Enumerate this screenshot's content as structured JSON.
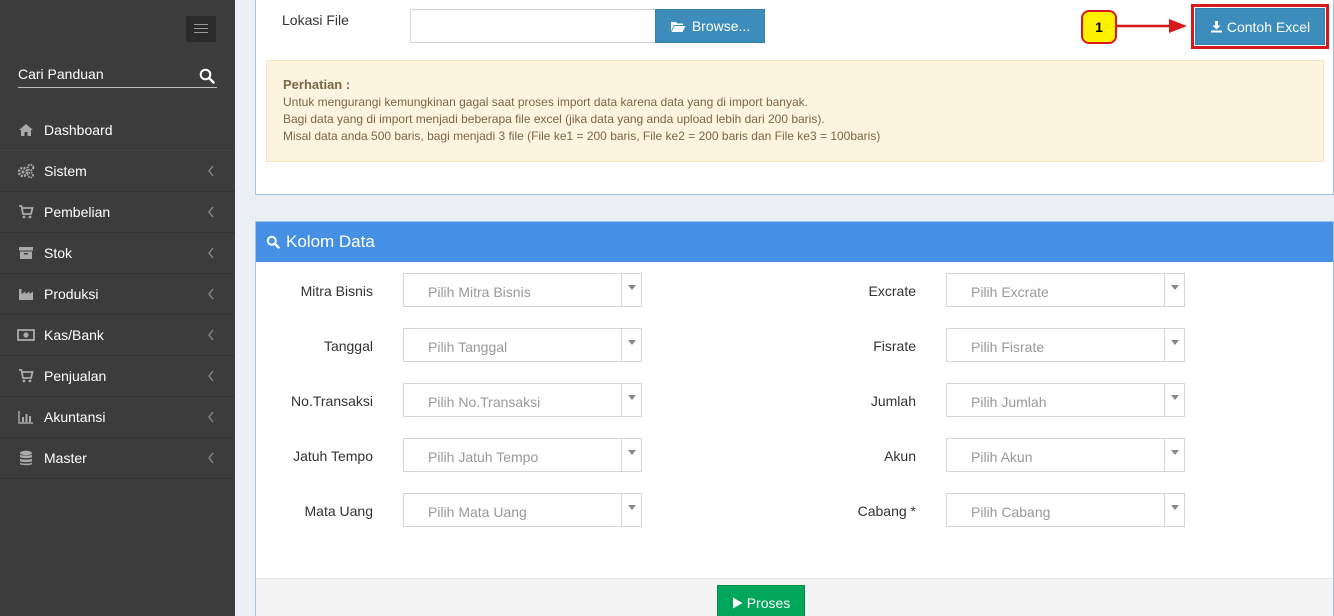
{
  "sidebar": {
    "search_label": "Cari Panduan",
    "items": [
      {
        "label": "Dashboard",
        "icon": "dashboard-icon"
      },
      {
        "label": "Sistem",
        "icon": "gears-icon"
      },
      {
        "label": "Pembelian",
        "icon": "cart-icon"
      },
      {
        "label": "Stok",
        "icon": "archive-icon"
      },
      {
        "label": "Produksi",
        "icon": "factory-icon"
      },
      {
        "label": "Kas/Bank",
        "icon": "money-icon"
      },
      {
        "label": "Penjualan",
        "icon": "cart-icon"
      },
      {
        "label": "Akuntansi",
        "icon": "bar-chart-icon"
      },
      {
        "label": "Master",
        "icon": "database-icon"
      }
    ]
  },
  "upload": {
    "lokasi_label": "Lokasi File",
    "browse_label": "Browse...",
    "excel_label": "Contoh Excel",
    "callout_number": "1"
  },
  "notice": {
    "title": "Perhatian :",
    "lines": [
      "Untuk mengurangi kemungkinan gagal saat proses import data karena data yang di import banyak.",
      "Bagi data yang di import menjadi beberapa file excel (jika data yang anda upload lebih dari 200 baris).",
      "Misal data anda 500 baris, bagi menjadi 3 file (File ke1 = 200 baris, File ke2 = 200 baris dan File ke3 = 100baris)"
    ]
  },
  "kolom": {
    "title": "Kolom Data",
    "left_fields": [
      {
        "label": "Mitra Bisnis",
        "placeholder": "Pilih Mitra Bisnis"
      },
      {
        "label": "Tanggal",
        "placeholder": "Pilih Tanggal"
      },
      {
        "label": "No.Transaksi",
        "placeholder": "Pilih No.Transaksi"
      },
      {
        "label": "Jatuh Tempo",
        "placeholder": "Pilih Jatuh Tempo"
      },
      {
        "label": "Mata Uang",
        "placeholder": "Pilih Mata Uang"
      }
    ],
    "right_fields": [
      {
        "label": "Excrate",
        "placeholder": "Pilih Excrate"
      },
      {
        "label": "Fisrate",
        "placeholder": "Pilih Fisrate"
      },
      {
        "label": "Jumlah",
        "placeholder": "Pilih Jumlah"
      },
      {
        "label": "Akun",
        "placeholder": "Pilih Akun"
      },
      {
        "label": "Cabang *",
        "placeholder": "Pilih Cabang"
      }
    ],
    "proses_label": "Proses"
  },
  "colors": {
    "sidebar_bg": "#3c3c3c",
    "primary": "#3c8dbc",
    "header_blue": "#4590e5",
    "success": "#00a65a",
    "callout_yellow": "#fff200",
    "callout_red": "#d7191c"
  }
}
